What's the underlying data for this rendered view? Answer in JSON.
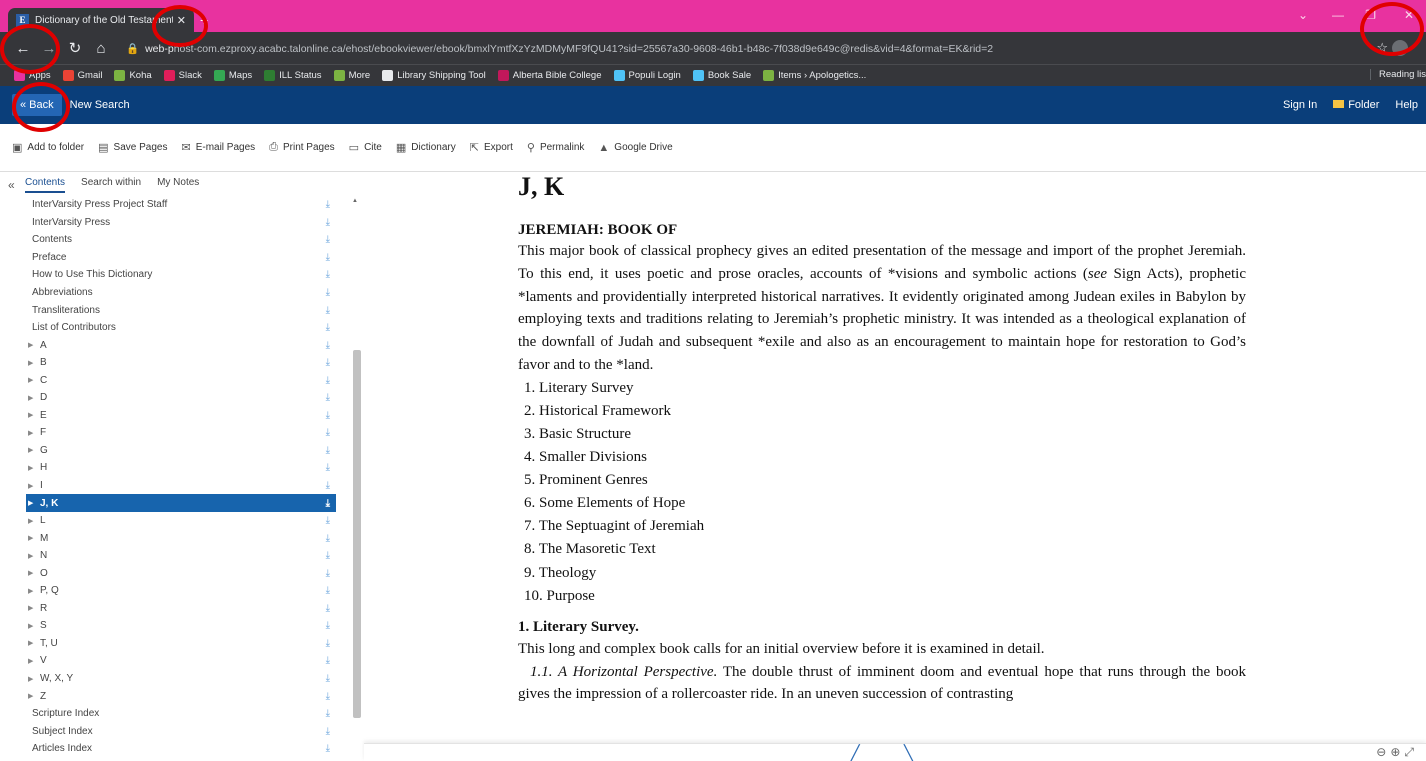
{
  "browser": {
    "tab_title": "Dictionary of the Old Testament: ",
    "favicon_letter": "E",
    "url_host": "web-p",
    "url_rest": "host-com.ezproxy.acabc.talonline.ca/ehost/ebookviewer/ebook/bmxlYmtfXzYzMDMyMF9fQU41?sid=25567a30-9608-46b1-b48c-7f038d9e649c@redis&vid=4&format=EK&rid=2",
    "bookmarks": [
      {
        "label": "Apps",
        "color": "#e8329f"
      },
      {
        "label": "Gmail",
        "color": "#ea4335"
      },
      {
        "label": "Koha",
        "color": "#7cb342"
      },
      {
        "label": "Slack",
        "color": "#e01e5a"
      },
      {
        "label": "Maps",
        "color": "#34a853"
      },
      {
        "label": "ILL Status",
        "color": "#2e7d32"
      },
      {
        "label": "More",
        "color": "#7cb342"
      },
      {
        "label": "Library Shipping Tool",
        "color": "#e8eaed"
      },
      {
        "label": "Alberta Bible College",
        "color": "#c2185b"
      },
      {
        "label": "Populi Login",
        "color": "#4fc3f7"
      },
      {
        "label": "Book Sale",
        "color": "#4fc3f7"
      },
      {
        "label": "Items › Apologetics...",
        "color": "#7cb342"
      }
    ],
    "reading_list": "Reading lis"
  },
  "header": {
    "back": "« Back",
    "new_search": "New Search",
    "sign_in": "Sign In",
    "folder": "Folder",
    "help": "Help"
  },
  "tools": [
    {
      "icon": "add-folder-icon",
      "glyph": "▣",
      "label": "Add to folder"
    },
    {
      "icon": "save-icon",
      "glyph": "▤",
      "label": "Save Pages"
    },
    {
      "icon": "email-icon",
      "glyph": "✉",
      "label": "E-mail Pages"
    },
    {
      "icon": "print-icon",
      "glyph": "⎙",
      "label": "Print Pages"
    },
    {
      "icon": "cite-icon",
      "glyph": "▭",
      "label": "Cite"
    },
    {
      "icon": "dictionary-icon",
      "glyph": "▦",
      "label": "Dictionary"
    },
    {
      "icon": "export-icon",
      "glyph": "⇱",
      "label": "Export"
    },
    {
      "icon": "permalink-icon",
      "glyph": "⚲",
      "label": "Permalink"
    },
    {
      "icon": "google-drive-icon",
      "glyph": "▲",
      "label": "Google Drive"
    }
  ],
  "panel_tabs": [
    "Contents",
    "Search within",
    "My Notes"
  ],
  "toc": [
    {
      "label": "InterVarsity Press Project Staff",
      "caret": false
    },
    {
      "label": "InterVarsity Press",
      "caret": false
    },
    {
      "label": "Contents",
      "caret": false
    },
    {
      "label": "Preface",
      "caret": false
    },
    {
      "label": "How to Use This Dictionary",
      "caret": false
    },
    {
      "label": "Abbreviations",
      "caret": false
    },
    {
      "label": "Transliterations",
      "caret": false
    },
    {
      "label": "List of Contributors",
      "caret": false
    },
    {
      "label": "A",
      "caret": true
    },
    {
      "label": "B",
      "caret": true
    },
    {
      "label": "C",
      "caret": true
    },
    {
      "label": "D",
      "caret": true
    },
    {
      "label": "E",
      "caret": true
    },
    {
      "label": "F",
      "caret": true
    },
    {
      "label": "G",
      "caret": true
    },
    {
      "label": "H",
      "caret": true
    },
    {
      "label": "I",
      "caret": true
    },
    {
      "label": "J, K",
      "caret": true,
      "selected": true
    },
    {
      "label": "L",
      "caret": true
    },
    {
      "label": "M",
      "caret": true
    },
    {
      "label": "N",
      "caret": true
    },
    {
      "label": "O",
      "caret": true
    },
    {
      "label": "P, Q",
      "caret": true
    },
    {
      "label": "R",
      "caret": true
    },
    {
      "label": "S",
      "caret": true
    },
    {
      "label": "T, U",
      "caret": true
    },
    {
      "label": "V",
      "caret": true
    },
    {
      "label": "W, X, Y",
      "caret": true
    },
    {
      "label": "Z",
      "caret": true
    },
    {
      "label": "Scripture Index",
      "caret": false
    },
    {
      "label": "Subject Index",
      "caret": false
    },
    {
      "label": "Articles Index",
      "caret": false
    }
  ],
  "content": {
    "section": "J, K",
    "entry_title": "JEREMIAH: BOOK OF",
    "intro_1": "This major book of classical prophecy gives an edited presentation of the message and import of the prophet Jeremiah. To this end, it uses poetic and prose oracles, accounts of *visions and symbolic actions (",
    "intro_see": "see",
    "intro_2": " Sign Acts), prophetic *laments and providentially interpreted historical narratives. It evidently originated among Judean exiles in Babylon by employing texts and traditions relating to Jeremiah’s prophetic ministry. It was intended as a theological explanation of the downfall of Judah and subsequent *exile and also as an encouragement to maintain hope for restoration to God’s favor and to the *land.",
    "outline": [
      "1. Literary Survey",
      "2. Historical Framework",
      "3. Basic Structure",
      "4. Smaller Divisions",
      "5. Prominent Genres",
      "6. Some Elements of Hope",
      "7. The Septuagint of Jeremiah",
      "8. The Masoretic Text",
      "9. Theology",
      "10. Purpose"
    ],
    "lit_heading": "1. Literary Survey.",
    "lit_intro": "This long and complex book calls for an initial overview before it is examined in detail.",
    "horiz_label": "1.1. A Horizontal Perspective.",
    "horiz_text": " The double thrust of imminent doom and eventual hope that runs through the book gives the impression of a rollercoaster ride. In an uneven succession of contrasting"
  }
}
